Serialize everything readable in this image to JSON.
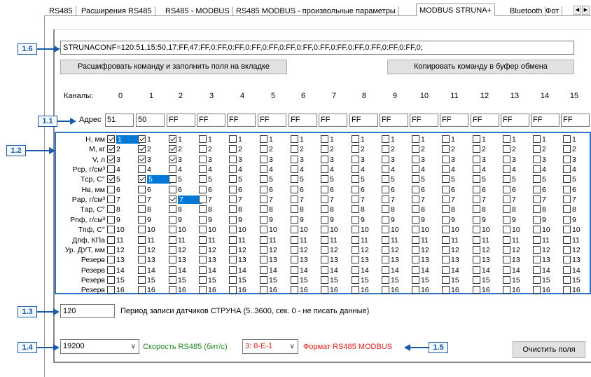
{
  "tabs": [
    {
      "label": "RS485",
      "active": false
    },
    {
      "label": "Расширения RS485",
      "active": false
    },
    {
      "label": "RS485 - MODBUS",
      "active": false
    },
    {
      "label": "RS485 MODBUS - произвольные параметры",
      "active": false
    },
    {
      "label": "MODBUS STRUNA+",
      "active": true
    },
    {
      "label": "Bluetooth",
      "active": false
    },
    {
      "label": "Фот",
      "active": false
    }
  ],
  "tab_scroll": {
    "left": "◀",
    "right": "▶"
  },
  "command": {
    "value": "STRUNACONF=120:51,15:50,17:FF,47:FF,0:FF,0:FF,0:FF,0:FF,0:FF,0:FF,0:FF,0:FF,0:FF,0:FF,0:FF,0:FF,0;",
    "decode_button": "Расшифровать команду и заполнить поля на вкладке",
    "copy_button": "Копировать команду в буфер обмена"
  },
  "channels": {
    "label": "Каналы:",
    "numbers": [
      "0",
      "1",
      "2",
      "3",
      "4",
      "5",
      "6",
      "7",
      "8",
      "9",
      "10",
      "11",
      "12",
      "13",
      "14",
      "15"
    ]
  },
  "address": {
    "label": "Адрес",
    "values": [
      "51",
      "50",
      "FF",
      "FF",
      "FF",
      "FF",
      "FF",
      "FF",
      "FF",
      "FF",
      "FF",
      "FF",
      "FF",
      "FF",
      "FF",
      "FF"
    ]
  },
  "params": {
    "labels": [
      "H, мм",
      "M, кг",
      "V, л",
      "Pср, г/см³",
      "Tср, С°",
      "Hв, мм",
      "Pар, г/см³",
      "Tар, С°",
      "Pпф, г/см³",
      "Tпф, С°",
      "Дпф, КПа",
      "Ур. ДУТ, мм",
      "Резерв",
      "Резерв",
      "Резерв",
      "Резерв"
    ],
    "numbers": [
      "1",
      "2",
      "3",
      "4",
      "5",
      "6",
      "7",
      "8",
      "9",
      "10",
      "11",
      "12",
      "13",
      "14",
      "15",
      "16"
    ],
    "checked": [
      [
        0,
        1,
        2,
        4
      ],
      [
        0,
        1,
        2,
        4
      ],
      [
        0,
        1,
        2,
        6
      ],
      [],
      [],
      [],
      [],
      [],
      [],
      [],
      [],
      [],
      [],
      [],
      [],
      []
    ],
    "selected": [
      [
        0
      ],
      [
        4
      ],
      [
        6
      ],
      [],
      [],
      [],
      [],
      [],
      [],
      [],
      [],
      [],
      [],
      [],
      [],
      []
    ]
  },
  "period": {
    "value": "120",
    "label": "Период записи датчиков СТРУНА (5..3600, сек. 0 - не писать данные)"
  },
  "speed": {
    "value": "19200",
    "label": "Скорость RS485 (бит/с)",
    "label_color": "#1e8a1e"
  },
  "format": {
    "value": "3:  8-E-1",
    "label": "Формат RS485 MODBUS",
    "color": "#e0201c"
  },
  "clear_button": "Очистить поля",
  "callouts": {
    "c16": "1.6",
    "c11": "1.1",
    "c12": "1.2",
    "c13": "1.3",
    "c14": "1.4",
    "c15": "1.5"
  },
  "callout_color": "#1a5aa8",
  "accent": "#0078d7"
}
